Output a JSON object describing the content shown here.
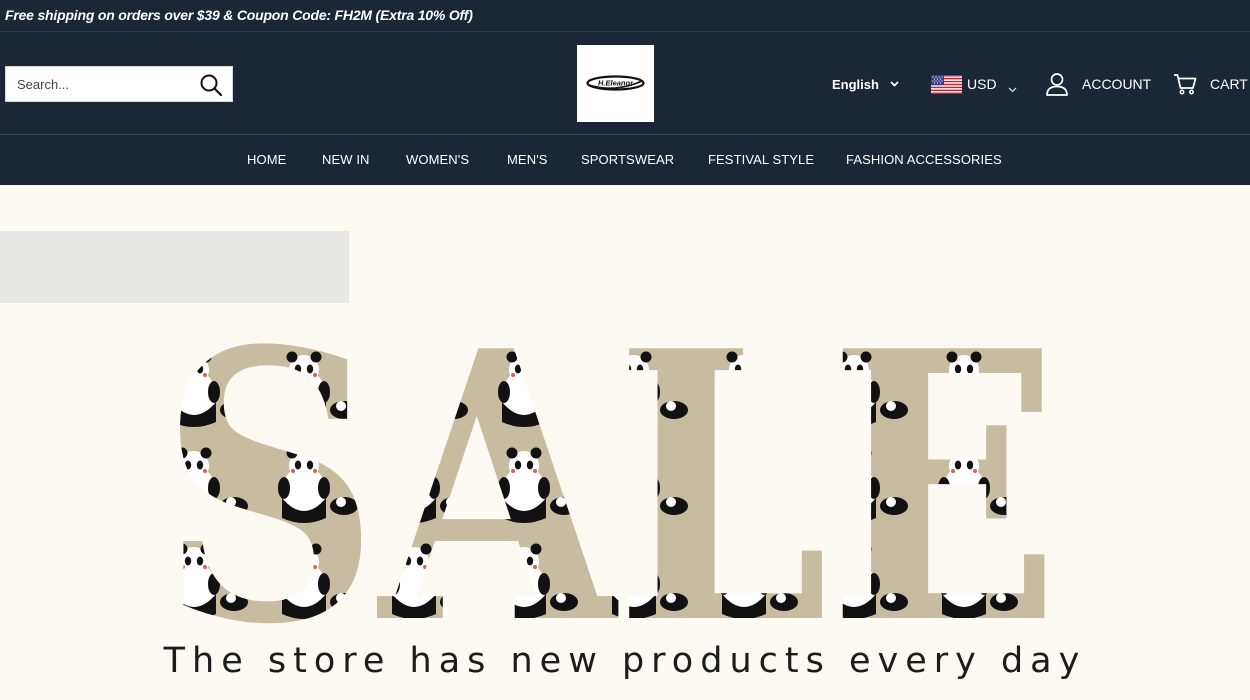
{
  "announcement": {
    "text": "Free shipping on orders over $39 & Coupon Code: FH2M (Extra 10% Off)"
  },
  "search": {
    "placeholder": "Search...",
    "icon": "search-icon"
  },
  "logo": {
    "text": "H.Eleanor"
  },
  "language": {
    "label": "English"
  },
  "currency": {
    "code": "USD",
    "flag": "us-flag-icon"
  },
  "account": {
    "label": "ACCOUNT"
  },
  "cart": {
    "label": "CART"
  },
  "nav": {
    "items": [
      "HOME",
      "NEW IN",
      "WOMEN'S",
      "MEN'S",
      "SPORTSWEAR",
      "FESTIVAL STYLE",
      "FASHION ACCESSORIES"
    ]
  },
  "hero": {
    "sale_text": "SALE",
    "tagline": "The store has new products every day"
  },
  "colors": {
    "header_bg": "#1b2636",
    "page_bg": "#fdfaf4",
    "sale_fill": "#c7bca0"
  }
}
